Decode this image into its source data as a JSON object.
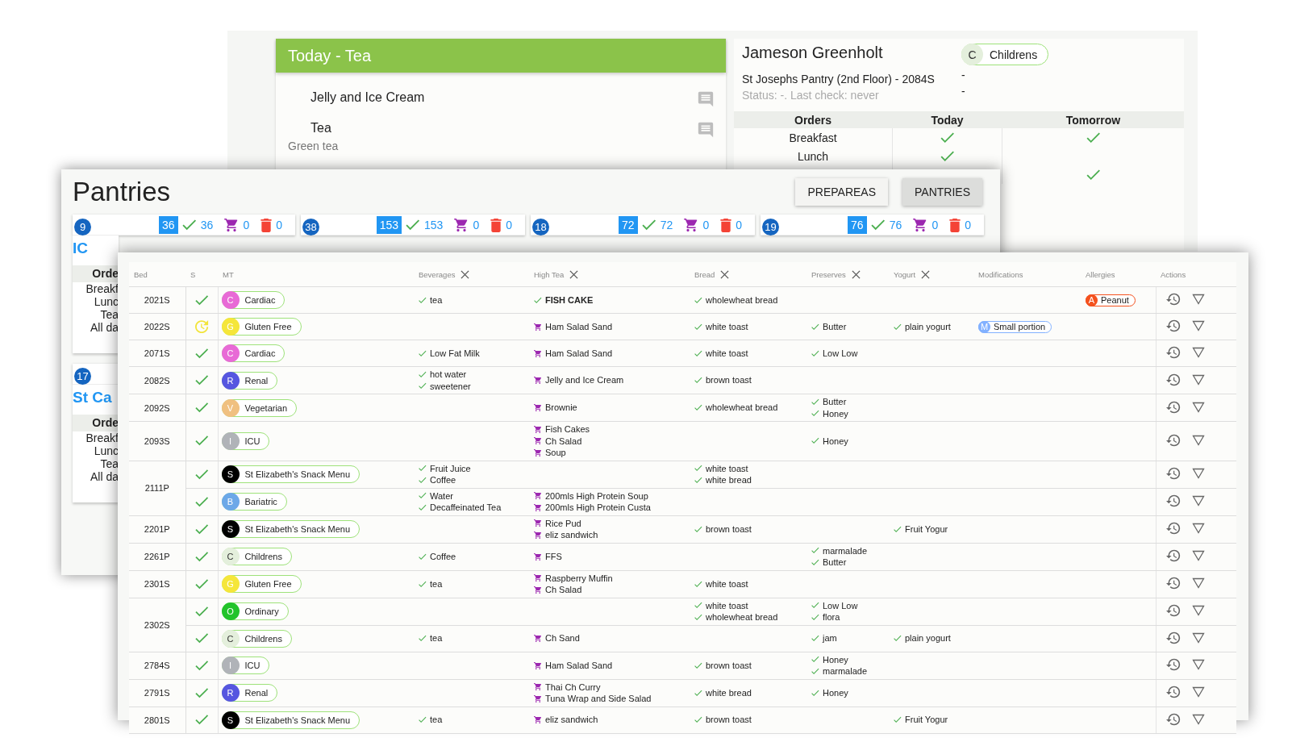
{
  "today_panel": {
    "title": "Today - Tea",
    "items": [
      {
        "name": "Jelly and Ice Cream"
      },
      {
        "name": "Tea",
        "note": "Green tea"
      }
    ]
  },
  "patient": {
    "name": "Jameson Greenholt",
    "diet": {
      "letter": "C",
      "label": "Childrens",
      "color": "#e4efdc"
    },
    "location": "St Josephs Pantry (2nd Floor) - 2084S",
    "extra_lines": [
      "-",
      "-"
    ],
    "status": "Status: -. Last check: never",
    "orders_table": {
      "columns": [
        "Orders",
        "Today",
        "Tomorrow"
      ],
      "rows": [
        {
          "label": "Breakfast",
          "today": true,
          "tomorrow": true
        },
        {
          "label": "Lunch",
          "today": true,
          "tomorrow": false
        },
        {
          "tomorrow": true
        }
      ]
    }
  },
  "pantries": {
    "title": "Pantries",
    "buttons": [
      {
        "label": "PREPAREAS",
        "selected": false
      },
      {
        "label": "PANTRIES",
        "selected": true
      }
    ],
    "cards": [
      {
        "number": "9",
        "total": "36",
        "done": "36",
        "cart": "0",
        "trash": "0",
        "name": "IC",
        "orders_header": "Orde",
        "rows": [
          "Breakf",
          "Lunc",
          "Tea",
          "All da"
        ]
      },
      {
        "number": "38",
        "total": "153",
        "done": "153",
        "cart": "0",
        "trash": "0"
      },
      {
        "number": "18",
        "total": "72",
        "done": "72",
        "cart": "0",
        "trash": "0"
      },
      {
        "number": "19",
        "total": "76",
        "done": "76",
        "cart": "0",
        "trash": "0"
      },
      {
        "number": "17",
        "name": "St Ca",
        "orders_header": "Orde",
        "rows": [
          "Breakf",
          "Lunc",
          "Tea",
          "All da"
        ]
      }
    ]
  },
  "meal_table": {
    "columns": [
      {
        "label": "Bed",
        "removable": false
      },
      {
        "label": "S",
        "removable": false
      },
      {
        "label": "MT",
        "removable": false
      },
      {
        "label": "Beverages",
        "removable": true
      },
      {
        "label": "High Tea",
        "removable": true
      },
      {
        "label": "Bread",
        "removable": true
      },
      {
        "label": "Preserves",
        "removable": true
      },
      {
        "label": "Yogurt",
        "removable": true
      },
      {
        "label": "Modifications",
        "removable": false
      },
      {
        "label": "Allergies",
        "removable": false
      },
      {
        "label": "Actions",
        "removable": false
      }
    ],
    "beds": [
      {
        "bed": "2021S",
        "entries": [
          {
            "kind": "done",
            "diet": {
              "letter": "C",
              "label": "Cardiac",
              "color": "#e86ad6"
            },
            "beverages": [
              "tea"
            ],
            "high_tea": [
              {
                "text": "FISH CAKE",
                "kind": "served",
                "bold": true
              }
            ],
            "bread": [
              "wholewheat bread"
            ],
            "allergies": [
              {
                "letter": "A",
                "label": "Peanut"
              }
            ]
          }
        ]
      },
      {
        "bed": "2022S",
        "entries": [
          {
            "kind": "pending",
            "diet": {
              "letter": "G",
              "label": "Gluten Free",
              "color": "#f5e63a"
            },
            "high_tea": [
              {
                "text": "Ham Salad Sand",
                "kind": "cart",
                "bold": false
              }
            ],
            "bread": [
              "white toast"
            ],
            "preserves": [
              "Butter"
            ],
            "yogurt": [
              "plain yogurt"
            ],
            "modifications": [
              {
                "letter": "M",
                "label": "Small portion"
              }
            ]
          }
        ]
      },
      {
        "bed": "2071S",
        "entries": [
          {
            "kind": "done",
            "diet": {
              "letter": "C",
              "label": "Cardiac",
              "color": "#e86ad6"
            },
            "beverages": [
              "Low Fat Milk"
            ],
            "high_tea": [
              {
                "text": "Ham Salad Sand",
                "kind": "cart",
                "bold": false
              }
            ],
            "bread": [
              "white toast"
            ],
            "preserves": [
              "Low Low"
            ]
          }
        ]
      },
      {
        "bed": "2082S",
        "entries": [
          {
            "kind": "done",
            "diet": {
              "letter": "R",
              "label": "Renal",
              "color": "#5656e0"
            },
            "beverages": [
              "hot water",
              "sweetener"
            ],
            "high_tea": [
              {
                "text": "Jelly and Ice Cream",
                "kind": "cart",
                "bold": false
              }
            ],
            "bread": [
              "brown toast"
            ]
          }
        ]
      },
      {
        "bed": "2092S",
        "entries": [
          {
            "kind": "done",
            "diet": {
              "letter": "V",
              "label": "Vegetarian",
              "color": "#f0c080"
            },
            "high_tea": [
              {
                "text": "Brownie",
                "kind": "cart",
                "bold": false
              }
            ],
            "bread": [
              "wholewheat bread"
            ],
            "preserves": [
              "Butter",
              "Honey"
            ]
          }
        ]
      },
      {
        "bed": "2093S",
        "entries": [
          {
            "kind": "done",
            "diet": {
              "letter": "I",
              "label": "ICU",
              "color": "#b0b3b8"
            },
            "high_tea": [
              {
                "text": "Fish Cakes",
                "kind": "cart",
                "bold": false
              },
              {
                "text": "Ch Salad",
                "kind": "cart",
                "bold": false
              },
              {
                "text": "Soup",
                "kind": "cart",
                "bold": false
              }
            ],
            "preserves": [
              "Honey"
            ]
          }
        ]
      },
      {
        "bed": "2111P",
        "entries": [
          {
            "kind": "done",
            "diet": {
              "letter": "S",
              "label": "St Elizabeth's Snack Menu",
              "color": "#000000"
            },
            "beverages": [
              "Fruit Juice",
              "Coffee"
            ],
            "bread": [
              "white toast",
              "white bread"
            ]
          },
          {
            "kind": "done",
            "diet": {
              "letter": "B",
              "label": "Bariatric",
              "color": "#6ca8e8"
            },
            "beverages": [
              "Water",
              "Decaffeinated Tea"
            ],
            "high_tea": [
              {
                "text": "200mls High Protein Soup",
                "kind": "cart",
                "bold": false
              },
              {
                "text": "200mls High Protein Custa",
                "kind": "cart",
                "bold": false
              }
            ]
          }
        ]
      },
      {
        "bed": "2201P",
        "entries": [
          {
            "kind": "done",
            "diet": {
              "letter": "S",
              "label": "St Elizabeth's Snack Menu",
              "color": "#000000"
            },
            "high_tea": [
              {
                "text": "Rice Pud",
                "kind": "cart",
                "bold": false
              },
              {
                "text": "eliz sandwich",
                "kind": "cart",
                "bold": false
              }
            ],
            "bread": [
              "brown toast"
            ],
            "yogurt": [
              "Fruit Yogur"
            ]
          }
        ]
      },
      {
        "bed": "2261P",
        "entries": [
          {
            "kind": "done",
            "diet": {
              "letter": "C",
              "label": "Childrens",
              "color": "#e4efdc"
            },
            "beverages": [
              "Coffee"
            ],
            "high_tea": [
              {
                "text": "FFS",
                "kind": "cart",
                "bold": false
              }
            ],
            "preserves": [
              "marmalade",
              "Butter"
            ]
          }
        ]
      },
      {
        "bed": "2301S",
        "entries": [
          {
            "kind": "done",
            "diet": {
              "letter": "G",
              "label": "Gluten Free",
              "color": "#f5e63a"
            },
            "beverages": [
              "tea"
            ],
            "high_tea": [
              {
                "text": "Raspberry Muffin",
                "kind": "cart",
                "bold": false
              },
              {
                "text": "Ch Salad",
                "kind": "cart",
                "bold": false
              }
            ],
            "bread": [
              "white toast"
            ]
          }
        ]
      },
      {
        "bed": "2302S",
        "entries": [
          {
            "kind": "done",
            "diet": {
              "letter": "O",
              "label": "Ordinary",
              "color": "#22c32a"
            },
            "bread": [
              "white toast",
              "wholewheat bread"
            ],
            "preserves": [
              "Low Low",
              "flora"
            ]
          },
          {
            "kind": "done",
            "diet": {
              "letter": "C",
              "label": "Childrens",
              "color": "#e4efdc"
            },
            "beverages": [
              "tea"
            ],
            "high_tea": [
              {
                "text": "Ch Sand",
                "kind": "cart",
                "bold": false
              }
            ],
            "preserves": [
              "jam"
            ],
            "yogurt": [
              "plain yogurt"
            ]
          }
        ]
      },
      {
        "bed": "2784S",
        "entries": [
          {
            "kind": "done",
            "diet": {
              "letter": "I",
              "label": "ICU",
              "color": "#b0b3b8"
            },
            "high_tea": [
              {
                "text": "Ham Salad Sand",
                "kind": "cart",
                "bold": false
              }
            ],
            "bread": [
              "brown toast"
            ],
            "preserves": [
              "Honey",
              "marmalade"
            ]
          }
        ]
      },
      {
        "bed": "2791S",
        "entries": [
          {
            "kind": "done",
            "diet": {
              "letter": "R",
              "label": "Renal",
              "color": "#5656e0"
            },
            "high_tea": [
              {
                "text": "Thai Ch Curry",
                "kind": "cart",
                "bold": false
              },
              {
                "text": "Tuna Wrap and Side Salad",
                "kind": "cart",
                "bold": false
              }
            ],
            "bread": [
              "white bread"
            ],
            "preserves": [
              "Honey"
            ]
          }
        ]
      },
      {
        "bed": "2801S",
        "entries": [
          {
            "kind": "done",
            "diet": {
              "letter": "S",
              "label": "St Elizabeth's Snack Menu",
              "color": "#000000"
            },
            "beverages": [
              "tea"
            ],
            "high_tea": [
              {
                "text": "eliz sandwich",
                "kind": "cart",
                "bold": false
              }
            ],
            "bread": [
              "brown toast"
            ],
            "yogurt": [
              "Fruit Yogur"
            ]
          }
        ]
      }
    ]
  }
}
